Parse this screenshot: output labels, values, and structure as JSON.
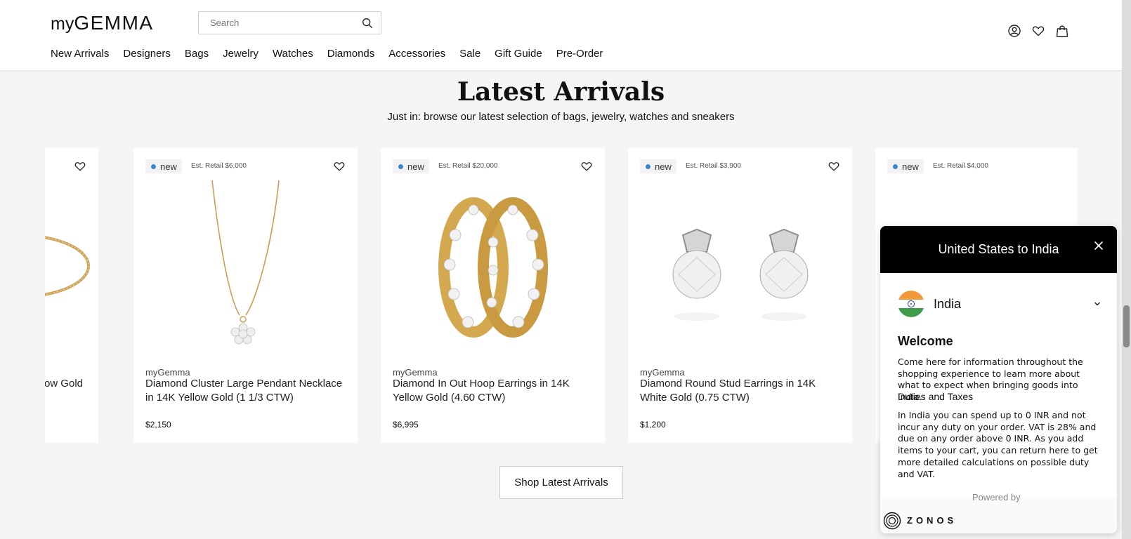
{
  "header": {
    "logo_small": "my",
    "logo_main": "GEMMA",
    "search_placeholder": "Search",
    "nav": [
      "New Arrivals",
      "Designers",
      "Bags",
      "Jewelry",
      "Watches",
      "Diamonds",
      "Accessories",
      "Sale",
      "Gift Guide",
      "Pre-Order"
    ],
    "icons": [
      "account-icon",
      "wishlist-heart-icon",
      "shopping-bag-icon"
    ]
  },
  "section": {
    "title": "Latest Arrivals",
    "subtitle": "Just in: browse our latest selection of bags, jewelry, watches and sneakers",
    "button": "Shop Latest Arrivals"
  },
  "products": [
    {
      "badge": "",
      "retail": "",
      "brand": "",
      "title": "...Yellow Gold",
      "price": "",
      "image": "bracelet-gold-partial"
    },
    {
      "badge": "new",
      "retail": "Est. Retail $6,000",
      "brand": "myGemma",
      "title": "Diamond Cluster Large Pendant Necklace in 14K Yellow Gold (1 1/3 CTW)",
      "price": "$2,150",
      "image": "gold-pendant-necklace"
    },
    {
      "badge": "new",
      "retail": "Est. Retail $20,000",
      "brand": "myGemma",
      "title": "Diamond In Out Hoop Earrings in 14K Yellow Gold (4.60 CTW)",
      "price": "$6,995",
      "image": "gold-diamond-hoop-earrings"
    },
    {
      "badge": "new",
      "retail": "Est. Retail $3,900",
      "brand": "myGemma",
      "title": "Diamond Round Stud Earrings in 14K White Gold (0.75 CTW)",
      "price": "$1,200",
      "image": "white-gold-stud-earrings"
    },
    {
      "badge": "new",
      "retail": "Est. Retail $4,000",
      "brand": "",
      "title": "",
      "price": "",
      "image": "obscured"
    }
  ],
  "modal": {
    "title": "United States to India",
    "country": "India",
    "welcome": "Welcome",
    "welcome_text": "Come here for information throughout the shopping experience to learn more about what to expect when bringing goods into India.",
    "duties_title": "Duties and Taxes",
    "duties_text": "In India you can spend up to 0 INR and not incur any duty on your order. VAT is 28% and due on any order above 0 INR. As you add items to your cart, you can return here to get more detailed calculations on possible duty and VAT.",
    "powered_by": "Powered by",
    "zonos": "ZONOS"
  },
  "colors": {
    "accent_dot": "#3a86c8",
    "modal_header": "#000000",
    "background": "#f5f5f5"
  }
}
